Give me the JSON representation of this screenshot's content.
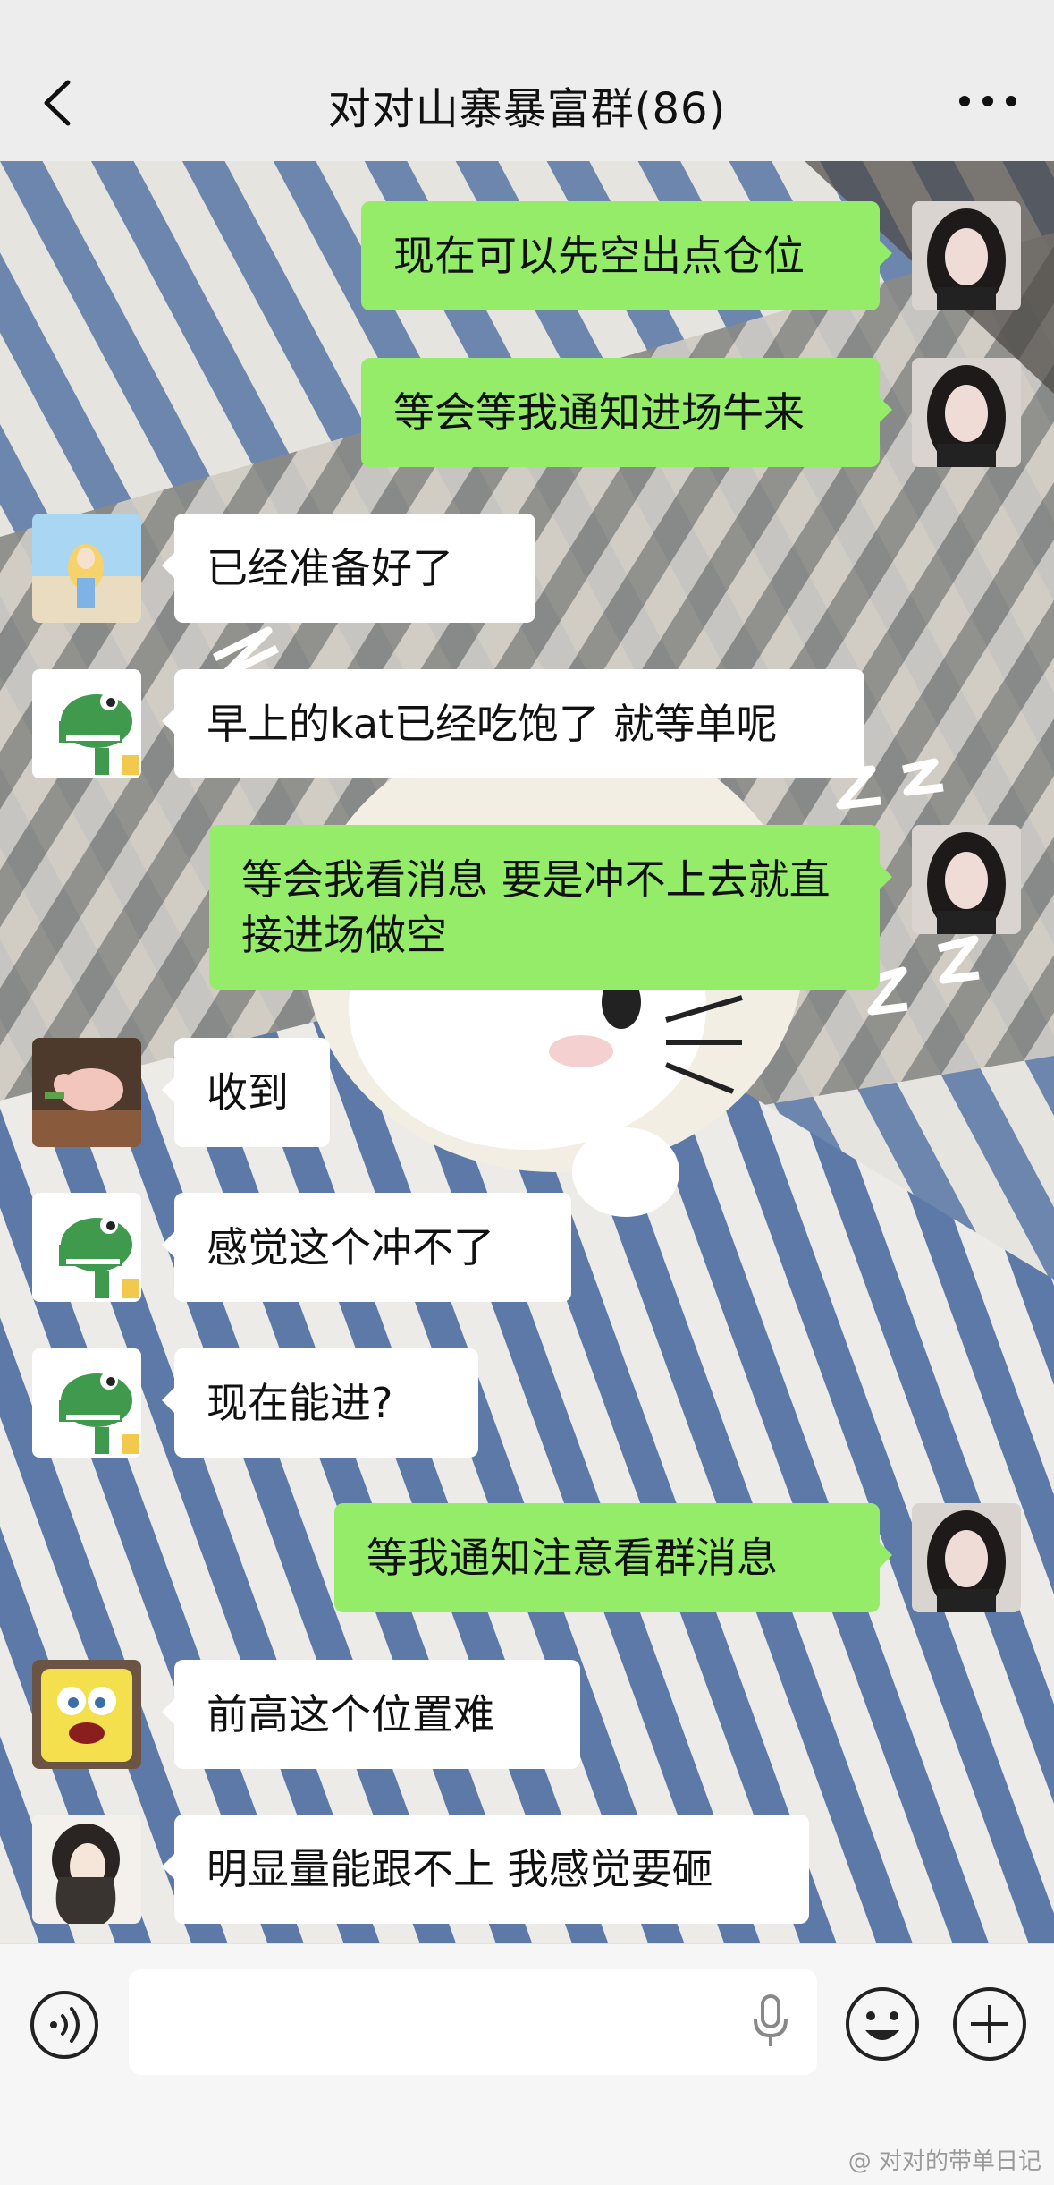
{
  "header": {
    "title": "对对山寨暴富群(86)"
  },
  "messages": [
    {
      "dir": "out",
      "text": "现在可以先空出点仓位"
    },
    {
      "dir": "out",
      "text": "等会等我通知进场牛来"
    },
    {
      "dir": "in",
      "text": "已经准备好了"
    },
    {
      "dir": "in",
      "text": "早上的kat已经吃饱了 就等单呢"
    },
    {
      "dir": "out",
      "text": "等会我看消息 要是冲不上去就直接进场做空"
    },
    {
      "dir": "in",
      "text": "收到"
    },
    {
      "dir": "in",
      "text": "感觉这个冲不了"
    },
    {
      "dir": "in",
      "text": "现在能进?"
    },
    {
      "dir": "out",
      "text": "等我通知注意看群消息"
    },
    {
      "dir": "in",
      "text": "前高这个位置难"
    },
    {
      "dir": "in",
      "text": "明显量能跟不上 我感觉要砸"
    }
  ],
  "input": {
    "placeholder": ""
  },
  "watermark": "@ 对对的带单日记",
  "colors": {
    "outgoing_bubble": "#95ec69",
    "incoming_bubble": "#ffffff",
    "header_bg": "#ededed"
  }
}
